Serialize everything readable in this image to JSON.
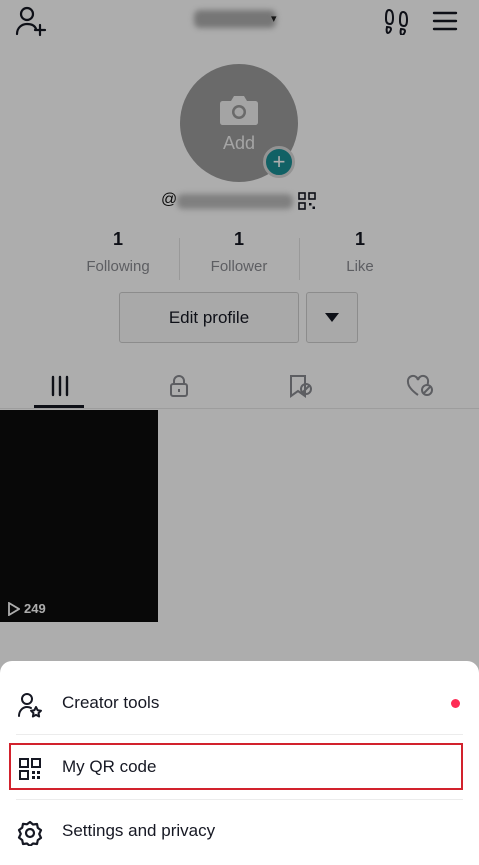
{
  "header": {
    "add_friend_icon": "person-plus-icon",
    "footprints_icon": "footprints-icon",
    "menu_icon": "hamburger-menu-icon"
  },
  "profile": {
    "avatar_label": "Add",
    "handle_prefix": "@"
  },
  "stats": [
    {
      "value": "1",
      "label": "Following"
    },
    {
      "value": "1",
      "label": "Follower"
    },
    {
      "value": "1",
      "label": "Like"
    }
  ],
  "actions": {
    "edit_profile": "Edit profile"
  },
  "video": {
    "plays": "249"
  },
  "sheet": {
    "items": [
      {
        "label": "Creator tools",
        "icon": "person-star-icon"
      },
      {
        "label": "My QR code",
        "icon": "qr-code-icon"
      },
      {
        "label": "Settings and privacy",
        "icon": "gear-icon"
      }
    ]
  },
  "colors": {
    "accent_dot": "#fe2c55",
    "highlight_box": "#d2222d",
    "plus_badge": "#1a8f96"
  }
}
